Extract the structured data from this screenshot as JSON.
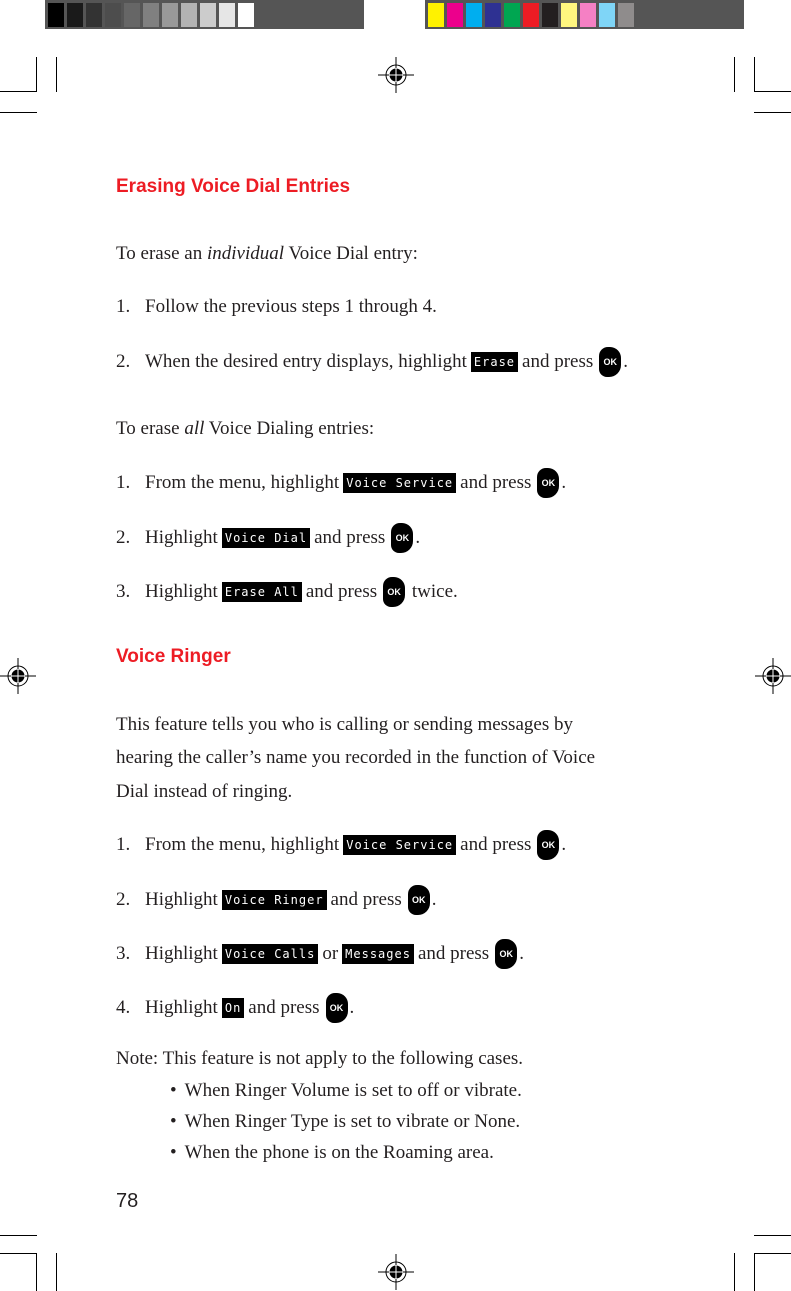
{
  "color_bars": {
    "grayscale": [
      "#000000",
      "#1a1a1a",
      "#333333",
      "#4d4d4d",
      "#666666",
      "#808080",
      "#999999",
      "#b3b3b3",
      "#cccccc",
      "#e6e6e6",
      "#ffffff"
    ],
    "colors": [
      "#fff200",
      "#ec008c",
      "#00aeef",
      "#2e3192",
      "#00a651",
      "#ed1c24",
      "#231f20",
      "#fff77f",
      "#f580c4",
      "#7fd5f7",
      "#8f8c8c"
    ]
  },
  "section1": {
    "title": "Erasing Voice Dial Entries",
    "intro_individual": {
      "before": "To erase an ",
      "emphasis": "individual",
      "after": " Voice Dial entry:"
    },
    "individual_steps": [
      {
        "num": "1.",
        "text_before": "Follow the previous steps 1 through 4."
      },
      {
        "num": "2.",
        "text_before": "When the desired entry displays, highlight",
        "lcd": "Erase",
        "text_after": "and press",
        "key": "OK",
        "end": "."
      }
    ],
    "intro_all": {
      "before": "To erase ",
      "emphasis": "all",
      "after": " Voice Dialing entries:"
    },
    "all_steps": [
      {
        "num": "1.",
        "text_before": "From the menu, highlight",
        "lcd": "Voice Service",
        "text_after": "and press",
        "key": "OK",
        "end": "."
      },
      {
        "num": "2.",
        "text_before": "Highlight",
        "lcd": "Voice Dial",
        "text_after": "and press",
        "key": "OK",
        "end": "."
      },
      {
        "num": "3.",
        "text_before": "Highlight",
        "lcd": "Erase All",
        "text_after": "and press",
        "key": "OK",
        "end": " twice."
      }
    ]
  },
  "section2": {
    "title": "Voice Ringer",
    "description": [
      "This feature tells you who is calling or sending messages by",
      "hearing the caller’s name you recorded in the function of Voice",
      "Dial instead of ringing."
    ],
    "steps": [
      {
        "num": "1.",
        "text_before": "From the menu, highlight",
        "lcd": "Voice Service",
        "text_after": "and press",
        "key": "OK",
        "end": "."
      },
      {
        "num": "2.",
        "text_before": "Highlight",
        "lcd": "Voice Ringer",
        "text_after": "and press",
        "key": "OK",
        "end": "."
      },
      {
        "num": "3.",
        "text_before": "Highlight",
        "lcd": "Voice Calls",
        "or": "or",
        "lcd2": "Messages",
        "text_after": "and press",
        "key": "OK",
        "end": "."
      },
      {
        "num": "4.",
        "text_before": "Highlight",
        "lcd": "On",
        "text_after": "and press",
        "key": "OK",
        "end": "."
      }
    ],
    "note": {
      "label": "Note:",
      "text": "This feature is not apply to the following cases.",
      "bullets": [
        "When Ringer Volume is set to off or vibrate.",
        "When Ringer Type is set to vibrate or None.",
        "When the phone is on the Roaming area."
      ]
    }
  },
  "page_number": "78"
}
